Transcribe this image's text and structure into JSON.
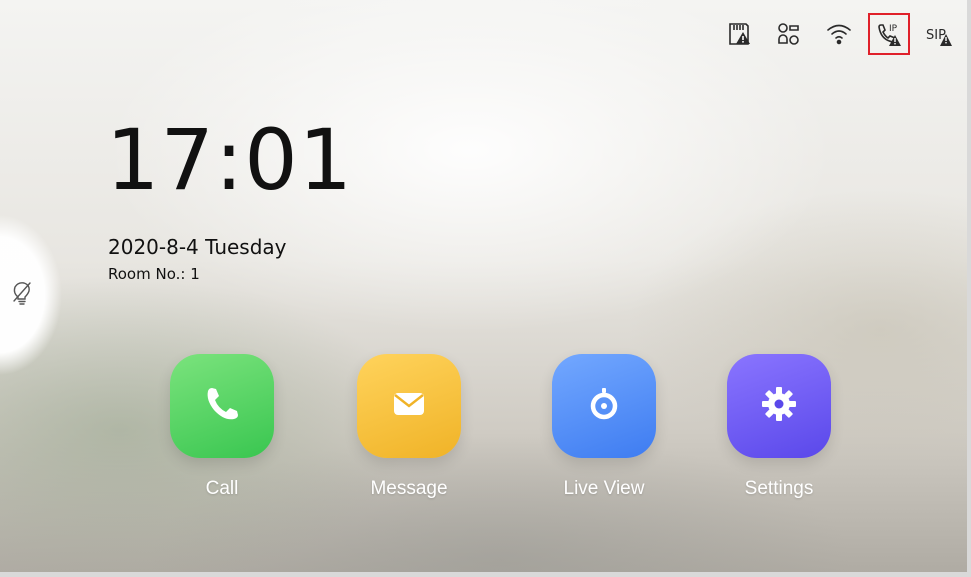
{
  "status_bar": {
    "icons": [
      {
        "name": "sd-card-warning-icon",
        "highlighted": false
      },
      {
        "name": "network-nodes-icon",
        "highlighted": false
      },
      {
        "name": "wifi-icon",
        "highlighted": false
      },
      {
        "name": "ip-call-warning-icon",
        "label": "IP",
        "highlighted": true,
        "highlight_color": "#e0202a"
      },
      {
        "name": "sip-warning-icon",
        "label": "SIP",
        "highlighted": false
      }
    ]
  },
  "clock": {
    "time": "17:01"
  },
  "date": {
    "text": "2020-8-4  Tuesday"
  },
  "room": {
    "text": "Room No.: 1"
  },
  "side_tab": {
    "icon": "bulb-off-icon"
  },
  "apps": [
    {
      "key": "call",
      "label": "Call",
      "icon": "phone-icon",
      "color": "#39c650"
    },
    {
      "key": "message",
      "label": "Message",
      "icon": "envelope-icon",
      "color": "#f0b327"
    },
    {
      "key": "liveview",
      "label": "Live View",
      "icon": "camera-icon",
      "color": "#3e7cf1"
    },
    {
      "key": "settings",
      "label": "Settings",
      "icon": "gear-icon",
      "color": "#5a48ea"
    }
  ]
}
